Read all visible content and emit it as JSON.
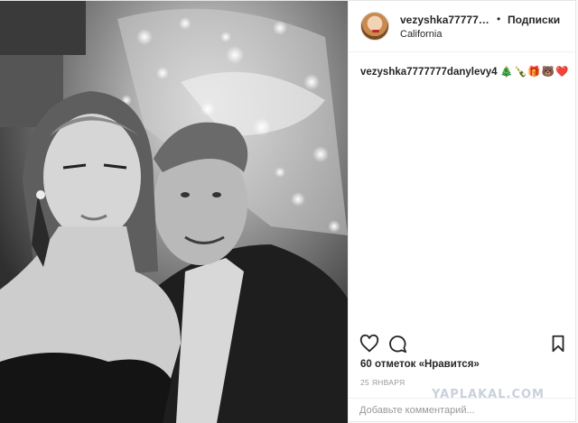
{
  "post": {
    "username": "vezyshka7777777danylevy4",
    "follow_label": "Подписки",
    "separator": "•",
    "location": "California",
    "caption_user": "vezyshka7777777danylevy4",
    "caption_emojis": "🎄🍾🎁🐻❤️",
    "likes_text": "60 отметок «Нравится»",
    "date_text": "25 ЯНВАРЯ",
    "comment_placeholder": "Добавьте комментарий..."
  },
  "photo": {
    "description_icon": "christmas-tree-selfie-photo"
  },
  "watermark": "YAPLAKAL.COM",
  "colors": {
    "text": "#262626",
    "muted": "#999999",
    "border": "#efefef",
    "watermark": "#c9d1db"
  }
}
